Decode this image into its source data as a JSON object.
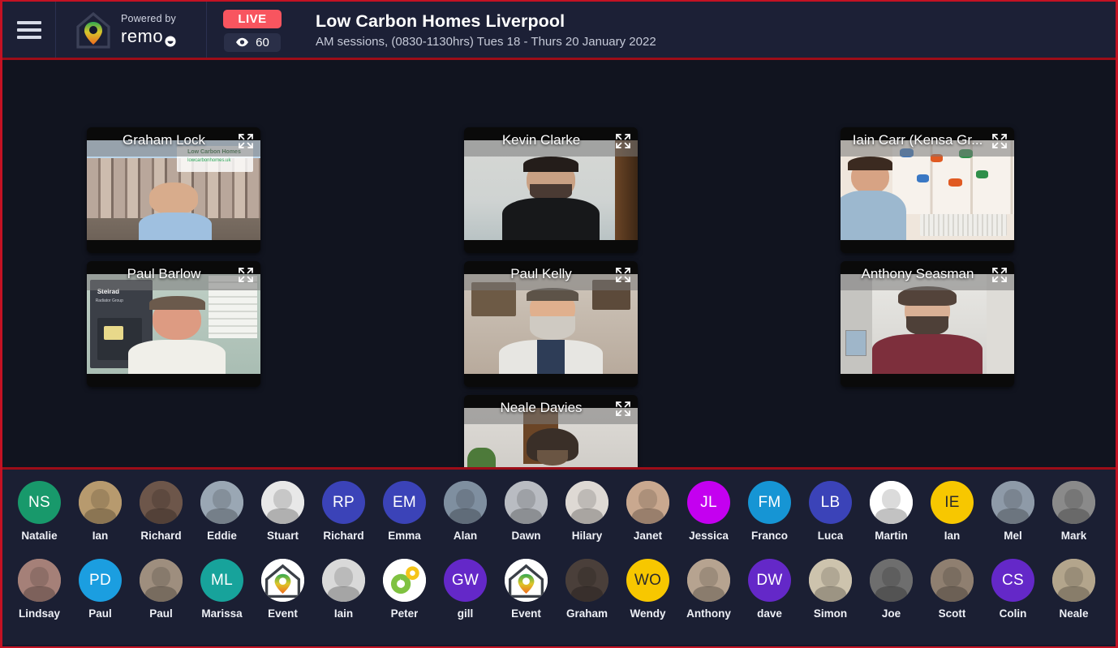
{
  "header": {
    "menu_label": "menu",
    "brand": {
      "powered_by": "Powered by",
      "name": "remo"
    },
    "live_label": "LIVE",
    "viewer_count": "60",
    "title": "Low Carbon Homes Liverpool",
    "subtitle": "AM sessions, (0830-1130hrs) Tues 18 - Thurs 20 January 2022",
    "accent_live": "#f8555f",
    "accent_border": "#c41223"
  },
  "stage": {
    "tiles": [
      {
        "name": "Graham Lock",
        "col": 0,
        "row": 0
      },
      {
        "name": "Kevin Clarke",
        "col": 1,
        "row": 0
      },
      {
        "name": "Iain Carr (Kensa Gr...",
        "col": 2,
        "row": 0
      },
      {
        "name": "Paul Barlow",
        "col": 0,
        "row": 1
      },
      {
        "name": "Paul Kelly",
        "col": 1,
        "row": 1
      },
      {
        "name": "Anthony Seasman",
        "col": 2,
        "row": 1
      },
      {
        "name": "Neale Davies",
        "col": 1,
        "row": 2
      }
    ]
  },
  "participants": {
    "row1": [
      {
        "name": "Natalie",
        "initials": "NS",
        "color": "#18996b",
        "photo": false
      },
      {
        "name": "Ian",
        "initials": "",
        "color": "#b79a6e",
        "photo": true
      },
      {
        "name": "Richard",
        "initials": "",
        "color": "#6d564a",
        "photo": true
      },
      {
        "name": "Eddie",
        "initials": "",
        "color": "#9aa7b4",
        "photo": true
      },
      {
        "name": "Stuart",
        "initials": "",
        "color": "#e8e8e8",
        "photo": true
      },
      {
        "name": "Richard",
        "initials": "RP",
        "color": "#3b43b8",
        "photo": false
      },
      {
        "name": "Emma",
        "initials": "EM",
        "color": "#3b43b8",
        "photo": false
      },
      {
        "name": "Alan",
        "initials": "",
        "color": "#7f8fa0",
        "photo": true
      },
      {
        "name": "Dawn",
        "initials": "",
        "color": "#b9bcc2",
        "photo": true
      },
      {
        "name": "Hilary",
        "initials": "",
        "color": "#ded9d4",
        "photo": true
      },
      {
        "name": "Janet",
        "initials": "",
        "color": "#c9a88f",
        "photo": true
      },
      {
        "name": "Jessica",
        "initials": "JL",
        "color": "#c400f0",
        "photo": false
      },
      {
        "name": "Franco",
        "initials": "FM",
        "color": "#1695d4",
        "photo": false
      },
      {
        "name": "Luca",
        "initials": "LB",
        "color": "#3b43b8",
        "photo": false
      },
      {
        "name": "Martin",
        "initials": "",
        "color": "#ffffff",
        "photo": true
      },
      {
        "name": "Ian",
        "initials": "IE",
        "color": "#f7c700",
        "photo": false
      },
      {
        "name": "Mel",
        "initials": "",
        "color": "#8e9aa8",
        "photo": true
      },
      {
        "name": "Mark",
        "initials": "",
        "color": "#8a8a8a",
        "photo": true
      }
    ],
    "row2": [
      {
        "name": "Lindsay",
        "initials": "",
        "color": "#a58078",
        "photo": true
      },
      {
        "name": "Paul",
        "initials": "PD",
        "color": "#1b9ee0",
        "photo": false
      },
      {
        "name": "Paul",
        "initials": "",
        "color": "#9e8e7e",
        "photo": true
      },
      {
        "name": "Marissa",
        "initials": "ML",
        "color": "#17a39b",
        "photo": false
      },
      {
        "name": "Event",
        "initials": "",
        "color": "#ffffff",
        "photo": false,
        "icon": "house-logo"
      },
      {
        "name": "Iain",
        "initials": "",
        "color": "#d9d9d9",
        "photo": true
      },
      {
        "name": "Peter",
        "initials": "",
        "color": "#ffffff",
        "photo": false,
        "icon": "gears-logo"
      },
      {
        "name": "gill",
        "initials": "GW",
        "color": "#6428c8",
        "photo": false
      },
      {
        "name": "Event",
        "initials": "",
        "color": "#ffffff",
        "photo": false,
        "icon": "house-logo"
      },
      {
        "name": "Graham",
        "initials": "",
        "color": "#4a3f3a",
        "photo": true
      },
      {
        "name": "Wendy",
        "initials": "WO",
        "color": "#f7c700",
        "photo": false
      },
      {
        "name": "Anthony",
        "initials": "",
        "color": "#b6a390",
        "photo": true
      },
      {
        "name": "dave",
        "initials": "DW",
        "color": "#6428c8",
        "photo": false
      },
      {
        "name": "Simon",
        "initials": "",
        "color": "#cdc3ad",
        "photo": true
      },
      {
        "name": "Joe",
        "initials": "",
        "color": "#6e6e6e",
        "photo": true
      },
      {
        "name": "Scott",
        "initials": "",
        "color": "#8f7f70",
        "photo": true
      },
      {
        "name": "Colin",
        "initials": "CS",
        "color": "#6428c8",
        "photo": false
      },
      {
        "name": "Neale",
        "initials": "",
        "color": "#b3a58c",
        "photo": true
      }
    ]
  }
}
